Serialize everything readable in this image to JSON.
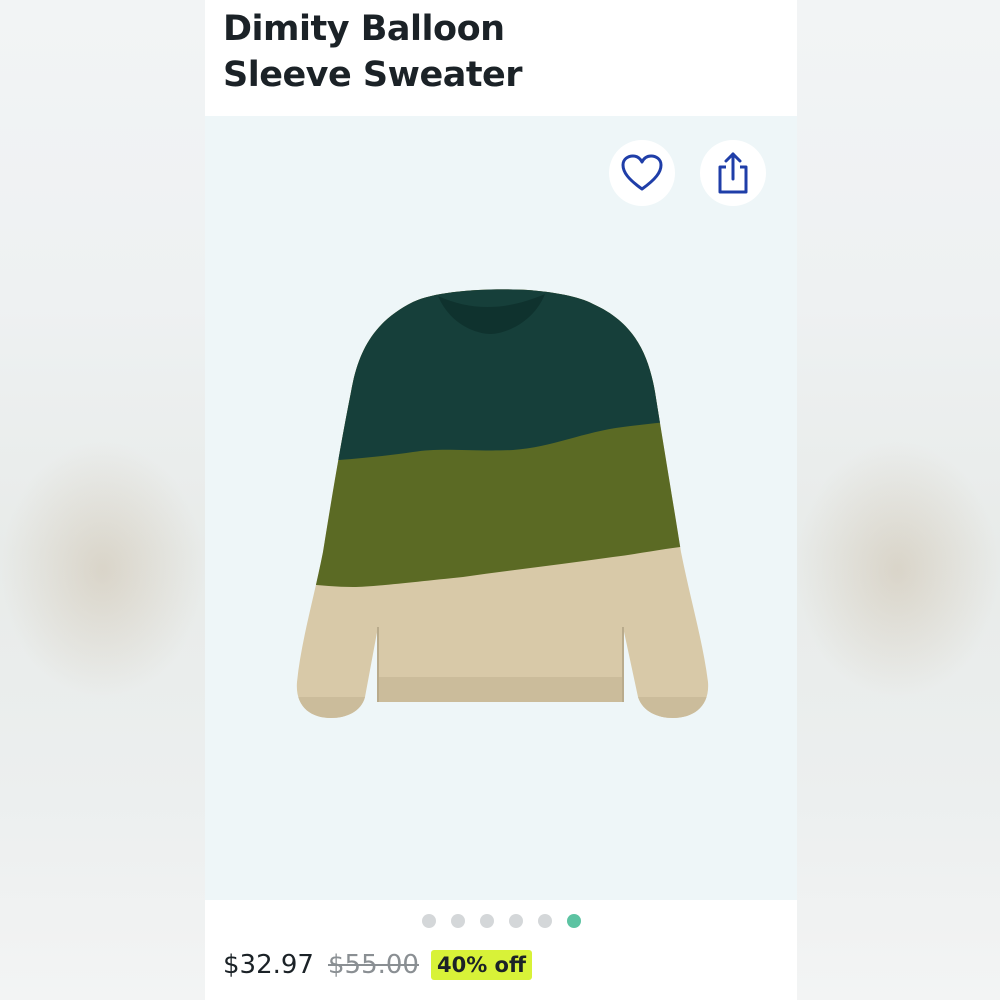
{
  "product": {
    "title_line1": "Dimity Balloon",
    "title_line2": "Sleeve Sweater",
    "price": "$32.97",
    "original_price": "$55.00",
    "discount": "40% off"
  },
  "gallery": {
    "dot_count": 6,
    "active_index": 5
  },
  "icons": {
    "favorite": "heart-icon",
    "share": "share-icon"
  },
  "colors": {
    "accent_dot": "#5cc3a2",
    "discount_badge": "#d8f238",
    "icon_blue": "#1f3ea8",
    "sweater_top": "#163f3a",
    "sweater_middle": "#5b6a24",
    "sweater_bottom": "#d8c9a8"
  }
}
